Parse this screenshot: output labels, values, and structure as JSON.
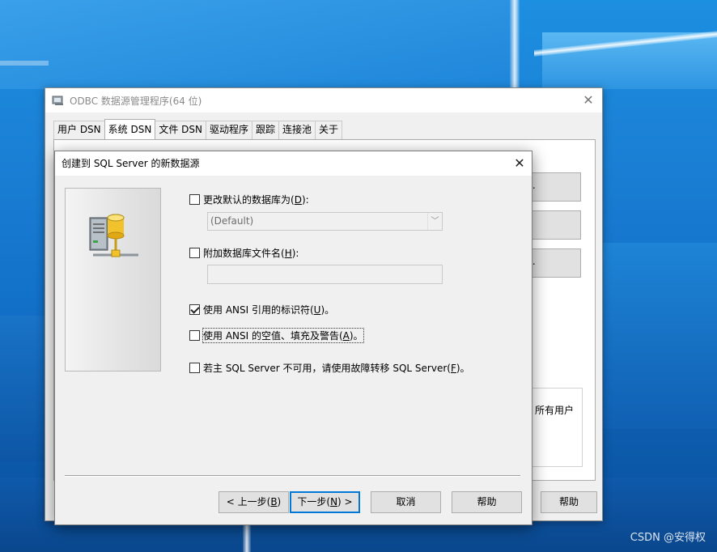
{
  "desktop": {
    "watermark": "CSDN @安得权"
  },
  "odbc_window": {
    "title": "ODBC 数据源管理程序(64 位)",
    "tabs": [
      {
        "label": "用户 DSN"
      },
      {
        "label": "系统 DSN",
        "active": true
      },
      {
        "label": "文件 DSN"
      },
      {
        "label": "驱动程序"
      },
      {
        "label": "跟踪"
      },
      {
        "label": "连接池"
      },
      {
        "label": "关于"
      }
    ],
    "side_buttons": [
      "..",
      "",
      ".."
    ],
    "info_text": "所有用户",
    "help_label": "帮助"
  },
  "dialog": {
    "title": "创建到 SQL Server 的新数据源",
    "options": {
      "change_default_db": {
        "label_pre": "更改默认的数据库为(",
        "accel": "D",
        "label_post": "):",
        "checked": false
      },
      "default_db_value": "(Default)",
      "attach_db_file": {
        "label_pre": "附加数据库文件名(",
        "accel": "H",
        "label_post": "):",
        "checked": false
      },
      "attach_db_value": "",
      "ansi_quoted": {
        "label_pre": "使用 ANSI 引用的标识符(",
        "accel": "U",
        "label_post": ")。",
        "checked": true
      },
      "ansi_nulls": {
        "label_pre": "使用 ANSI 的空值、填充及警告(",
        "accel": "A",
        "label_post": ")。",
        "checked": false
      },
      "failover": {
        "label_pre": "若主 SQL Server 不可用，请使用故障转移 SQL Server(",
        "accel": "F",
        "label_post": ")。",
        "checked": false
      }
    },
    "buttons": {
      "back": {
        "pre": "< 上一步(",
        "accel": "B",
        "post": ")"
      },
      "next": {
        "pre": "下一步(",
        "accel": "N",
        "post": ") >"
      },
      "cancel": "取消",
      "help": "帮助"
    }
  },
  "colors": {
    "accent": "#0078d7",
    "window_bg": "#f0f0f0"
  }
}
